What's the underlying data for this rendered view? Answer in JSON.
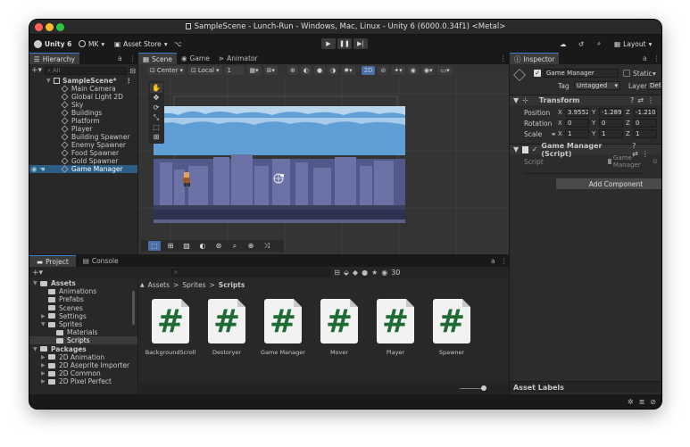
{
  "window": {
    "title": "SampleScene - Lunch-Run - Windows, Mac, Linux - Unity 6 (6000.0.34f1) <Metal>"
  },
  "toolbar": {
    "unity_label": "Unity 6",
    "account_label": "MK",
    "asset_store_label": "Asset Store",
    "layout_label": "Layout"
  },
  "hierarchy": {
    "tab_label": "Hierarchy",
    "search_placeholder": "All",
    "scene_name": "SampleScene*",
    "items": [
      "Main Camera",
      "Global Light 2D",
      "Sky",
      "Buildings",
      "Platform",
      "Player",
      "Building Spawner",
      "Enemy Spawner",
      "Food Spawner",
      "Gold Spawner",
      "Game Manager"
    ],
    "selected_index": 10
  },
  "scene_view": {
    "tabs": [
      "Scene",
      "Game",
      "Animator"
    ],
    "active_tab": 0,
    "pivot_label": "Center",
    "space_label": "Local",
    "grid_value": "1",
    "mode_2d_label": "2D"
  },
  "inspector": {
    "tab_label": "Inspector",
    "object_name": "Game Manager",
    "static_label": "Static",
    "tag_label": "Tag",
    "tag_value": "Untagged",
    "layer_label": "Layer",
    "layer_value": "Default",
    "transform": {
      "header": "Transform",
      "position_label": "Position",
      "rotation_label": "Rotation",
      "scale_label": "Scale",
      "position": {
        "x": "3.9552",
        "y": "-1.2896",
        "z": "-1.2102"
      },
      "rotation": {
        "x": "0",
        "y": "0",
        "z": "0"
      },
      "scale": {
        "x": "1",
        "y": "1",
        "z": "1"
      }
    },
    "script_component": {
      "header": "Game Manager (Script)",
      "script_label": "Script",
      "script_value": "Game Manager"
    },
    "add_component_label": "Add Component",
    "asset_labels": "Asset Labels"
  },
  "project": {
    "tabs": [
      "Project",
      "Console"
    ],
    "active_tab": 0,
    "breadcrumb": [
      "Assets",
      "Sprites",
      "Scripts"
    ],
    "icon_count": "30",
    "tree": [
      {
        "label": "Assets",
        "level": 0,
        "bold": true
      },
      {
        "label": "Animations",
        "level": 1
      },
      {
        "label": "Prefabs",
        "level": 1
      },
      {
        "label": "Scenes",
        "level": 1
      },
      {
        "label": "Settings",
        "level": 1
      },
      {
        "label": "Sprites",
        "level": 1
      },
      {
        "label": "Materials",
        "level": 2
      },
      {
        "label": "Scripts",
        "level": 2,
        "selected": true
      },
      {
        "label": "Packages",
        "level": 0,
        "bold": true
      },
      {
        "label": "2D Animation",
        "level": 1
      },
      {
        "label": "2D Aseprite Importer",
        "level": 1
      },
      {
        "label": "2D Common",
        "level": 1
      },
      {
        "label": "2D Pixel Perfect",
        "level": 1
      }
    ],
    "assets": [
      {
        "glyph": "#",
        "name": "BackgroundScroll"
      },
      {
        "glyph": "#",
        "name": "Destoryer"
      },
      {
        "glyph": "#",
        "name": "Game Manager"
      },
      {
        "glyph": "#",
        "name": "Mover"
      },
      {
        "glyph": "#",
        "name": "Player"
      },
      {
        "glyph": "#",
        "name": "Spawner"
      }
    ]
  },
  "colors": {
    "accent": "#3a7fcf",
    "selection": "#2c5d87",
    "script_green": "#1e6b34"
  }
}
